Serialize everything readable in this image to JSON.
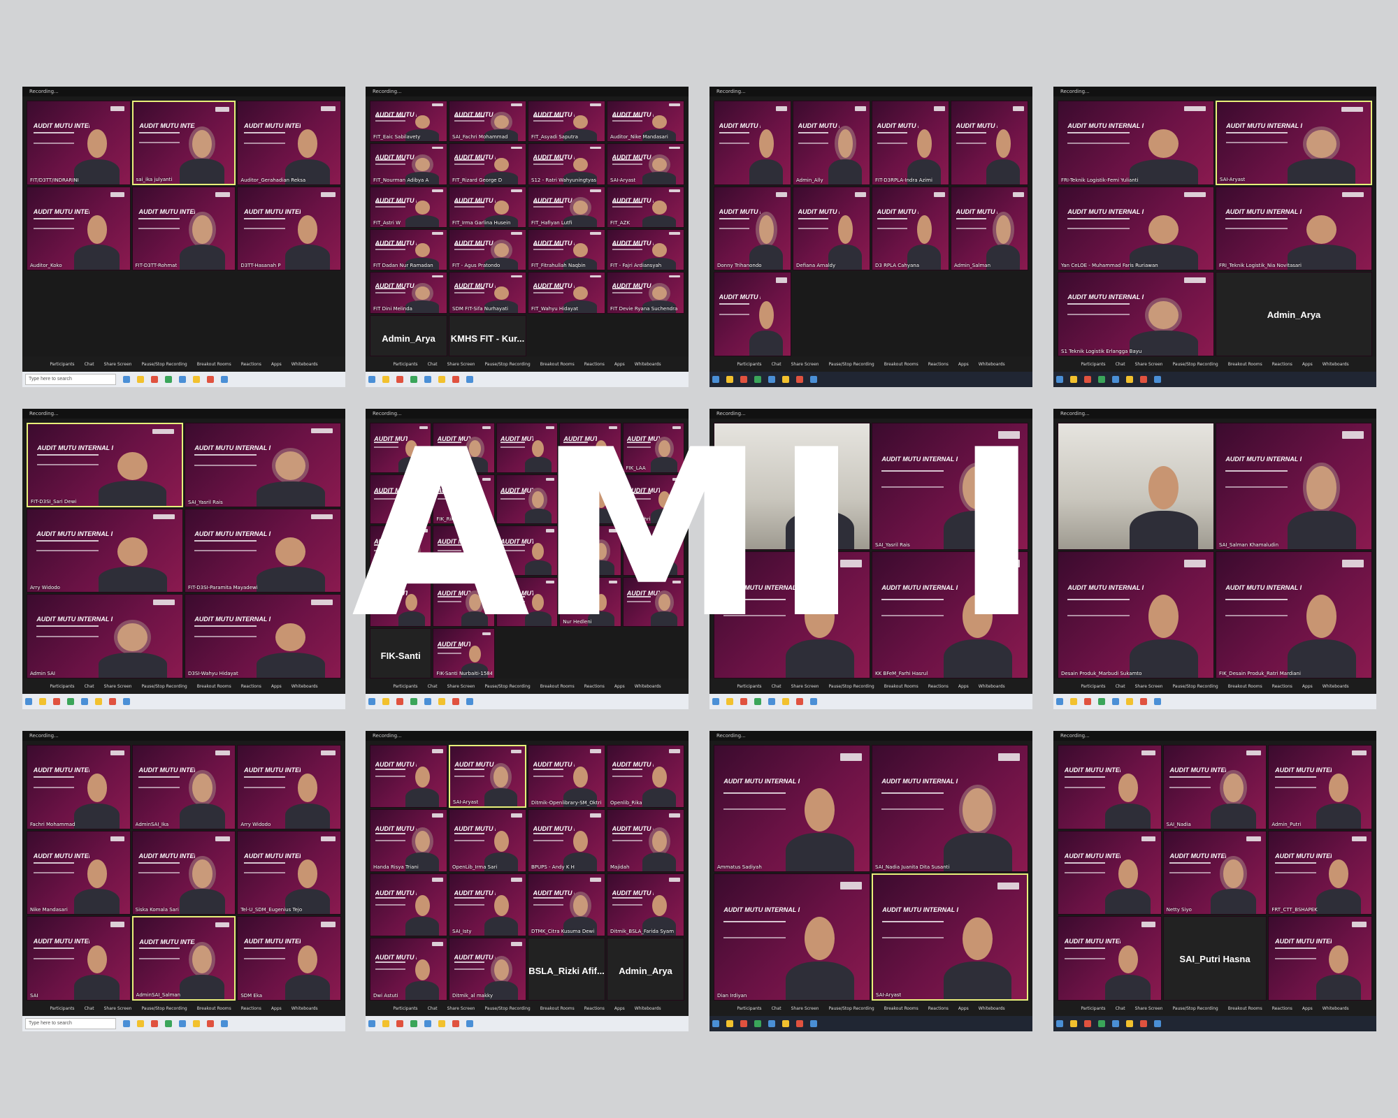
{
  "overlay_title": "AMI I",
  "slide_title": "AUDIT MUTU INTERNAL I",
  "taskbar_search": "Type here to search",
  "recording_label": "Recording...",
  "zoom_controls": [
    "Participants",
    "Chat",
    "Share Screen",
    "Pause/Stop Recording",
    "Breakout Rooms",
    "Reactions",
    "Apps",
    "Whiteboards"
  ],
  "screens": [
    {
      "grid": [
        3,
        3
      ],
      "tiles": [
        "FIT/D3TT/INDRARINI",
        "sai_ika julyanti",
        "Auditor_Gerahadian Reksa",
        "Auditor_Koko",
        "FIT-D3TT-Rohmat",
        "D3TT-Hasanah P"
      ]
    },
    {
      "grid": [
        4,
        6
      ],
      "tiles": [
        "FIT_Eaic Sabilavety",
        "SAI_Fachri Mohammad",
        "FIT_Asyadi Saputra",
        "Auditor_Nike Mandasari",
        "FIT_Nourman Adibya A",
        "FIT_Rizard George D",
        "S12 - Ratri Wahyuningtyas",
        "SAI-Aryast",
        "FIT_Astri W",
        "FIT_Irma Garlina Husein",
        "FIT_Hafiyan Lutfi",
        "FIT_AZK",
        "FIT Dadan Nur Ramadan",
        "FIT - Agus Pratondo",
        "FIT_Fitrahullah Naqbin",
        "FIT - Fajri Ardiansyah",
        "FIT Dini Melinda",
        "SDM FIT-Sifa Nurhayati",
        "FIT_Wahyu Hidayat",
        "FIT Devie Ryana Suchendra",
        "Admin_Arya",
        "KMHS FIT - Kur..."
      ]
    },
    {
      "grid": [
        4,
        3
      ],
      "tiles": [
        "",
        "Admin_Ally",
        "FIT-D3RPLA-Indra Azimi",
        "",
        "Donny Trihanondo",
        "Defiana Arnaldy",
        "D3 RPLA Cahyana",
        "Admin_Salman",
        ""
      ]
    },
    {
      "grid": [
        2,
        3
      ],
      "tiles": [
        "FRI-Teknik Logistik-Femi Yulianti",
        "SAI-Aryast",
        "Yan CeLOE - Muhammad Faris Ruriawan",
        "FRI_Teknik Logistik_Nia Novitasari",
        "S1 Teknik Logistik Erlangga Bayu",
        "Admin_Arya"
      ]
    },
    {
      "grid": [
        2,
        3
      ],
      "tiles": [
        "FIT-D3SI_Sari Dewi",
        "SAI_Yasril Rais",
        "Arry Widodo",
        "FIT-D3SI-Paramita Mayadewi",
        "Admin SAI",
        "D3SI-Wahyu Hidayat"
      ]
    },
    {
      "grid": [
        5,
        5
      ],
      "tiles": [
        "",
        "SAI_Yasril Rais",
        "",
        "Auditor",
        "FIK_LAA",
        "",
        "FIK_Rikas Ra",
        "",
        "",
        "FIK_Fachri",
        "",
        "",
        "",
        "",
        "",
        "",
        "",
        "",
        "Nur Hedleni",
        "",
        "FIK-Santi",
        "FIK-Santi Nurbaiti-15840086"
      ]
    },
    {
      "grid": [
        2,
        2
      ],
      "tiles": [
        "",
        "SAI_Yasril Rais",
        "",
        "KK BFeM_Farhi Hasrul"
      ]
    },
    {
      "grid": [
        2,
        2
      ],
      "tiles": [
        "",
        "SAI_Salman Khamaludin",
        "Desain Produk_Marbudi Sukamto",
        "FIK_Desain Produk_Ratri Mardiani"
      ]
    },
    {
      "grid": [
        3,
        3
      ],
      "tiles": [
        "Fachri Mohammad",
        "AdminSAI_Ika",
        "Arry Widodo",
        "Nike Mandasari",
        "Siska Komala Sari",
        "Tel-U_SDM_Eugenius Tejo",
        "SAI",
        "AdminSAI_Salman",
        "SDM Eka"
      ]
    },
    {
      "grid": [
        4,
        4
      ],
      "tiles": [
        "",
        "SAI-Aryast",
        "Ditmik-Openlibrary-SM_Oktriani",
        "Openlib_Rika",
        "Handa Risya Triani",
        "OpenLib_Irma Sari",
        "BPUPS - Andy K H",
        "Majidah",
        "",
        "SAI_Isty",
        "DTMK_Citra Kusuma Dewi",
        "Ditmik_BSLA_Farida Syam",
        "Dwi Astuti",
        "Ditmik_al makky",
        "BSLA_Rizki Afif...",
        "Admin_Arya"
      ]
    },
    {
      "grid": [
        2,
        2
      ],
      "tiles": [
        "Ammatus Sadiyah",
        "SAI_Nadia Juanita Dita Susanti",
        "Dian Irdiyan",
        "SAI-Aryast"
      ]
    },
    {
      "grid": [
        3,
        3
      ],
      "tiles": [
        "",
        "SAI_Nadia",
        "Admin_Putri",
        "",
        "Netty Siyo",
        "FRT_CTT_BSHAPEK",
        "",
        "SAI_Putri Hasna",
        ""
      ]
    }
  ]
}
